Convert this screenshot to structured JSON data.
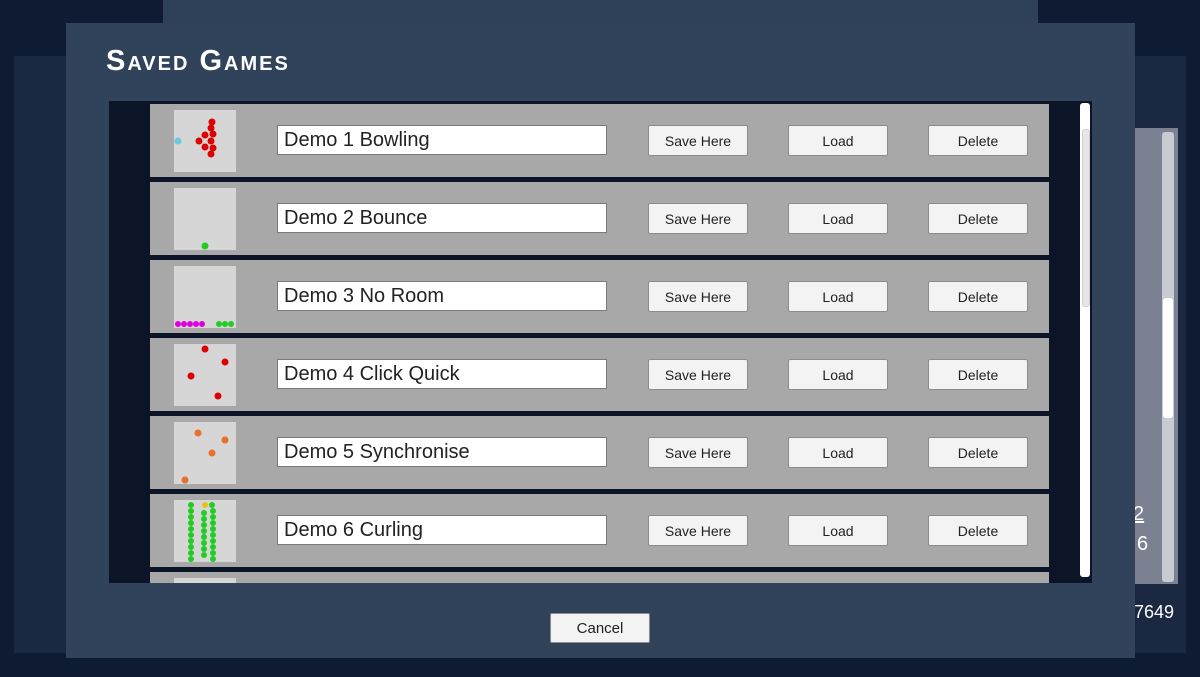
{
  "dialog": {
    "title": "Saved Games",
    "cancel_label": "Cancel"
  },
  "background_fragments": [
    "2",
    "6",
    "7649"
  ],
  "saves": [
    {
      "name": "Demo 1 Bowling",
      "save_label": "Save Here",
      "load_label": "Load",
      "delete_label": "Delete",
      "thumbnail": "bowling"
    },
    {
      "name": "Demo 2 Bounce",
      "save_label": "Save Here",
      "load_label": "Load",
      "delete_label": "Delete",
      "thumbnail": "bounce"
    },
    {
      "name": "Demo 3 No Room",
      "save_label": "Save Here",
      "load_label": "Load",
      "delete_label": "Delete",
      "thumbnail": "no-room"
    },
    {
      "name": "Demo 4 Click Quick",
      "save_label": "Save Here",
      "load_label": "Load",
      "delete_label": "Delete",
      "thumbnail": "click-quick"
    },
    {
      "name": "Demo 5 Synchronise",
      "save_label": "Save Here",
      "load_label": "Load",
      "delete_label": "Delete",
      "thumbnail": "synchronise"
    },
    {
      "name": "Demo 6 Curling",
      "save_label": "Save Here",
      "load_label": "Load",
      "delete_label": "Delete",
      "thumbnail": "curling"
    }
  ],
  "colors": {
    "modal_bg": "#31435b",
    "list_bg": "#0c1428",
    "row_bg": "#a8a8a8",
    "thumb_bg": "#d6d6d6",
    "ball_red": "#dd0000",
    "ball_green": "#22cc22",
    "ball_magenta": "#dd00dd",
    "ball_orange": "#e8702a",
    "ball_cyan": "#66ccdd",
    "ball_yellow": "#e8c020"
  }
}
